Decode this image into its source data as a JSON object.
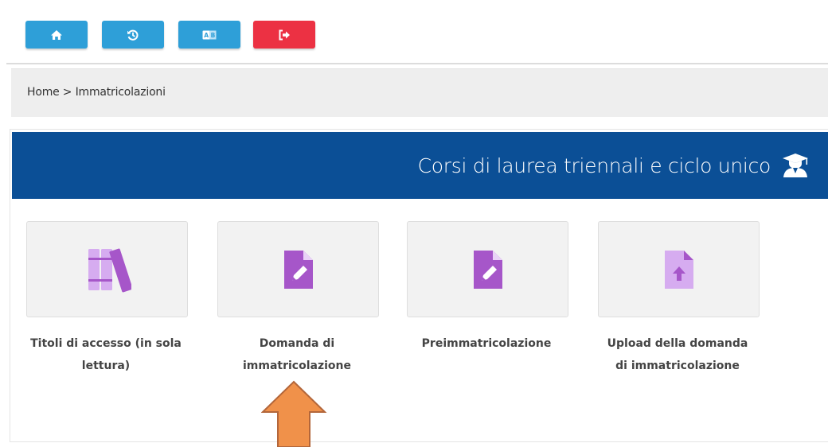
{
  "toolbar": {
    "buttons": [
      {
        "name": "home",
        "color": "#2e9fd8",
        "icon": "home-icon"
      },
      {
        "name": "history",
        "color": "#2e9fd8",
        "icon": "history-icon"
      },
      {
        "name": "language",
        "color": "#2e9fd8",
        "icon": "language-icon"
      },
      {
        "name": "logout",
        "color": "#ec3143",
        "icon": "sign-out-icon"
      }
    ]
  },
  "breadcrumb": {
    "home": "Home",
    "separator": " > ",
    "current": "Immatricolazioni"
  },
  "section": {
    "title": "Corsi di laurea triennali e ciclo unico",
    "title_icon": "graduate-icon",
    "banner_color": "#0b4f96"
  },
  "tiles": [
    {
      "icon": "books-icon",
      "line1": "Titoli di accesso (in sola",
      "line2": "lettura)"
    },
    {
      "icon": "file-edit-icon",
      "line1": "Domanda di",
      "line2": "immatricolazione"
    },
    {
      "icon": "file-edit-icon",
      "line1": "Preimmatricolazione",
      "line2": ""
    },
    {
      "icon": "file-upload-icon",
      "line1": "Upload della domanda",
      "line2": "di immatricolazione"
    }
  ],
  "accent": {
    "icon_color": "#a656c9",
    "icon_light": "#d6acf0",
    "annotation_arrow": "#f0914a"
  }
}
